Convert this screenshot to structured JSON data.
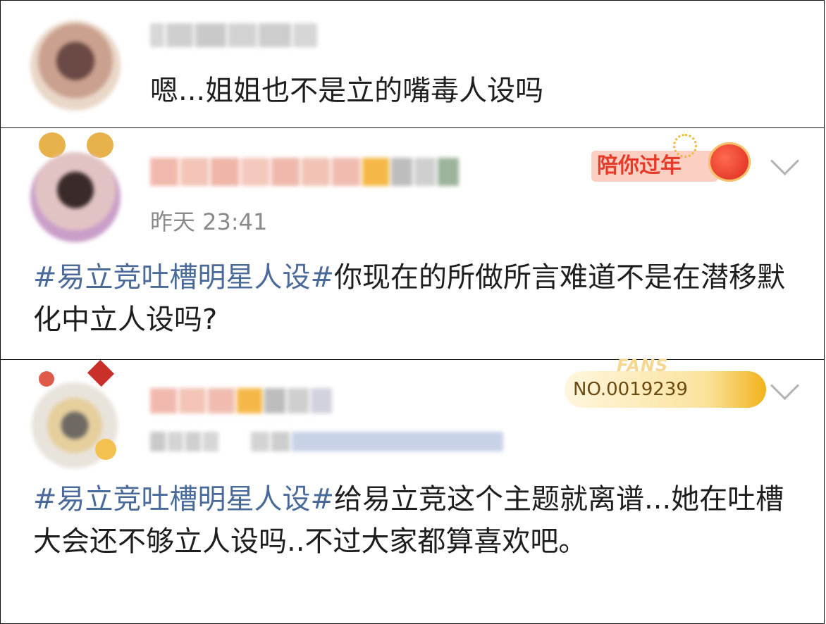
{
  "comments": [
    {
      "reply_text": "嗯...姐姐也不是立的嘴毒人设吗"
    },
    {
      "time": "昨天 23:41",
      "badge_text": "陪你过年",
      "hashtag": "#易立竞吐槽明星人设#",
      "body": "你现在的所做所言难道不是在潜移默化中立人设吗?"
    },
    {
      "fans_label": "FANS",
      "fans_number": "NO.0019239",
      "hashtag": "#易立竞吐槽明星人设#",
      "body": "给易立竞这个主题就离谱...她在吐槽大会还不够立人设吗..不过大家都算喜欢吧。"
    }
  ],
  "colors": {
    "hashtag": "#4a6b9a",
    "text": "#1e1e1e",
    "timestamp": "#8a8a8a",
    "badge_red": "#e63a2a",
    "fans_gold": "#f2b31b"
  },
  "icons": [
    "chevron-down-icon",
    "lantern-icon",
    "fans-badge-icon"
  ]
}
